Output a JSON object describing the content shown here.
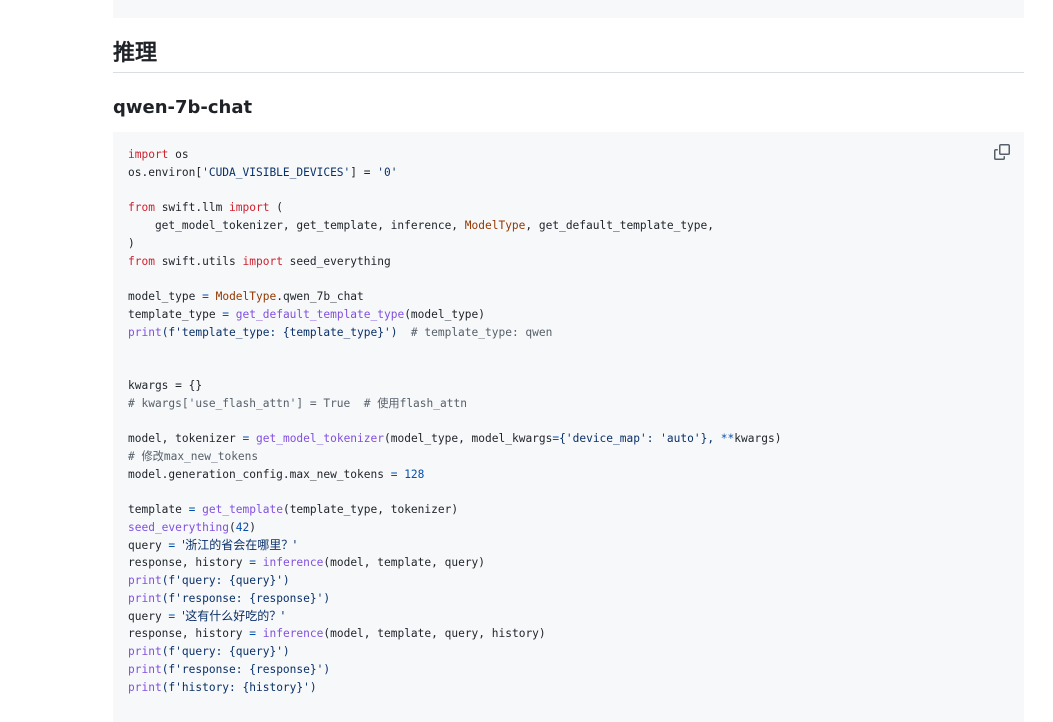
{
  "heading": "推理",
  "subheading": "qwen-7b-chat",
  "code_block": {
    "copy_icon": "copy-icon",
    "tokens": {
      "import": "import",
      "from": "from",
      "os": " os",
      "os_environ": "os.environ[",
      "cuda_key": "'CUDA_VISIBLE_DEVICES'",
      "bracket_eq": "] = ",
      "zero_str": "'0'",
      "swift_llm": " swift.llm ",
      "paren_open": " (",
      "import_list_1": "    get_model_tokenizer, get_template, inference, ",
      "ModelType": "ModelType",
      "import_list_2": ", get_default_template_type,",
      "paren_close": ")",
      "swift_utils": " swift.utils ",
      "seed_everything_import": " seed_everything",
      "model_type_var": "model_type ",
      "eq": "=",
      "model_type_val": ".qwen_7b_chat",
      "template_type_var": "template_type ",
      "get_default_template_type": "get_default_template_type",
      "model_type_arg": "(model_type)",
      "print": "print",
      "fstr_template_type": "(f'template_type: {template_type}')",
      "comment_template_type": "  # template_type: qwen",
      "kwargs_line": "kwargs = {}",
      "comment_flash": "# kwargs['use_flash_attn'] = True  # 使用flash_attn",
      "model_tokenizer_var": "model, tokenizer ",
      "get_model_tokenizer": "get_model_tokenizer",
      "model_tokenizer_args_1": "(model_type, model_kwargs",
      "model_tokenizer_args_2": "{'device_map': 'auto'}, ",
      "double_star": "**",
      "model_tokenizer_args_3": "kwargs)",
      "comment_max_tokens": "# 修改max_new_tokens",
      "gen_config": "model.generation_config.max_new_tokens ",
      "num_128": "128",
      "template_var": "template ",
      "get_template": "get_template",
      "get_template_args": "(template_type, tokenizer)",
      "seed_everything": "seed_everything",
      "num_42": "42",
      "query_var": "query ",
      "query_1": "'浙江的省会在哪里？'",
      "query_2": "'这有什么好吃的？'",
      "response_history_var": "response, history ",
      "inference": "inference",
      "inference_args_1": "(model, template, query)",
      "inference_args_2": "(model, template, query, history)",
      "fstr_query": "(f'query: {query}')",
      "fstr_response": "(f'response: {response}')",
      "fstr_history": "(f'history: {history}')",
      "paren_l": "(",
      "paren_r": ")",
      "space": " "
    }
  }
}
